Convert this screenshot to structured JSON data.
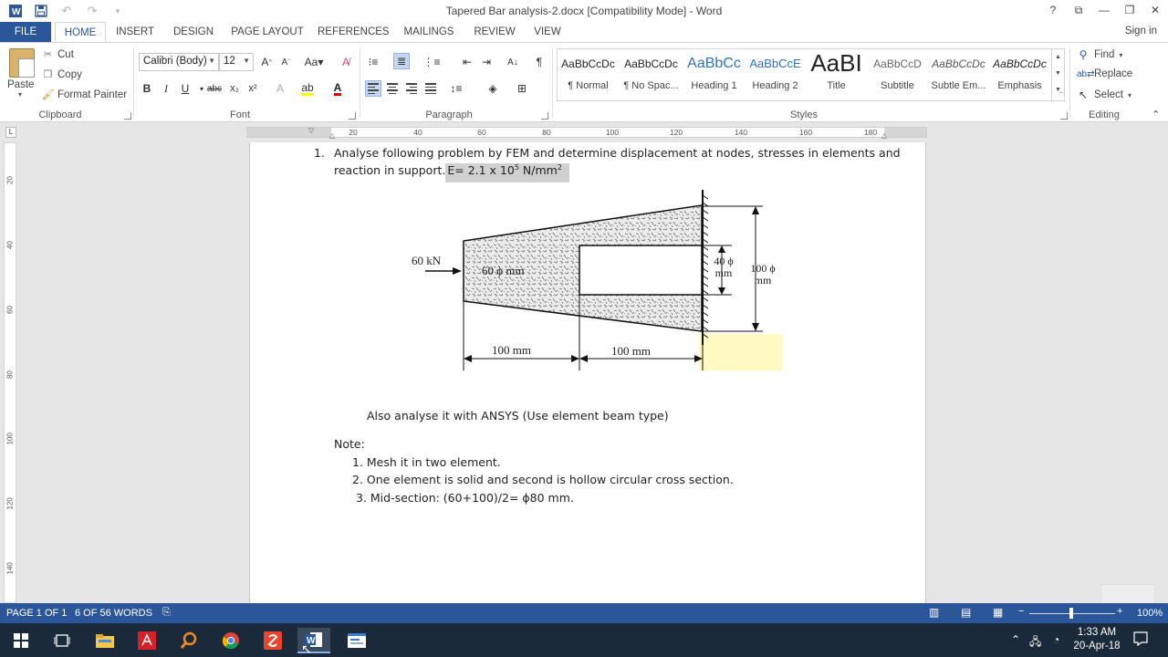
{
  "window": {
    "title": "Tapered Bar analysis-2.docx [Compatibility Mode] - Word",
    "controls": [
      "?",
      "⧉",
      "—",
      "❐",
      "✕"
    ]
  },
  "quick_access": [
    "save-icon",
    "undo-icon",
    "redo-icon",
    "customize-icon"
  ],
  "tabs": {
    "file": "FILE",
    "items": [
      "HOME",
      "INSERT",
      "DESIGN",
      "PAGE LAYOUT",
      "REFERENCES",
      "MAILINGS",
      "REVIEW",
      "VIEW"
    ],
    "active": "HOME",
    "sign_in": "Sign in"
  },
  "clipboard": {
    "paste": "Paste",
    "cut": "Cut",
    "copy": "Copy",
    "format_painter": "Format Painter",
    "group": "Clipboard"
  },
  "font": {
    "family": "Calibri (Body)",
    "size": "12",
    "group": "Font"
  },
  "paragraph": {
    "group": "Paragraph"
  },
  "styles": {
    "group": "Styles",
    "items": [
      {
        "preview": "AaBbCcDc",
        "name": "¶ Normal"
      },
      {
        "preview": "AaBbCcDc",
        "name": "¶ No Spac..."
      },
      {
        "preview": "AaBbCc",
        "name": "Heading 1"
      },
      {
        "preview": "AaBbCcE",
        "name": "Heading 2"
      },
      {
        "preview": "AaBI",
        "name": "Title"
      },
      {
        "preview": "AaBbCcD",
        "name": "Subtitle"
      },
      {
        "preview": "AaBbCcDc",
        "name": "Subtle Em..."
      },
      {
        "preview": "AaBbCcDc",
        "name": "Emphasis"
      }
    ]
  },
  "editing": {
    "find": "Find",
    "replace": "Replace",
    "select": "Select",
    "group": "Editing"
  },
  "ruler": {
    "numbers": [
      "20",
      "40",
      "60",
      "80",
      "100",
      "120",
      "140",
      "160",
      "180"
    ],
    "vertical": [
      "20",
      "40",
      "60",
      "80",
      "100",
      "120",
      "140"
    ]
  },
  "document": {
    "item_number": "1.",
    "problem_line1": "Analyse following problem by FEM and determine displacement at nodes, stresses in elements and",
    "problem_line2": "reaction in support.",
    "modulus": "E= 2.1 x 10",
    "modulus_exp": "5",
    "modulus_unit": " N/mm",
    "modulus_unit_exp": "2",
    "figure": {
      "load": "60 kN",
      "left_dia": "60 ϕ mm",
      "hole_dia_1": "40 ϕ",
      "hole_dia_2": "mm",
      "right_dia_1": "100 ϕ",
      "right_dia_2": "mm",
      "len_1": "100 mm",
      "len_2": "100 mm"
    },
    "also": "Also analyse it with ANSYS (Use element beam type)",
    "note": "Note:",
    "notes": [
      "1. Mesh it in two element.",
      "2. One element is solid and second is hollow circular cross section.",
      "3. Mid-section: (60+100)/2= ϕ80 mm."
    ]
  },
  "status": {
    "page": "PAGE 1 OF 1",
    "words": "6 OF 56 WORDS",
    "zoom": "100%"
  },
  "taskbar": {
    "time": "1:33 AM",
    "date": "20-Apr-18"
  }
}
